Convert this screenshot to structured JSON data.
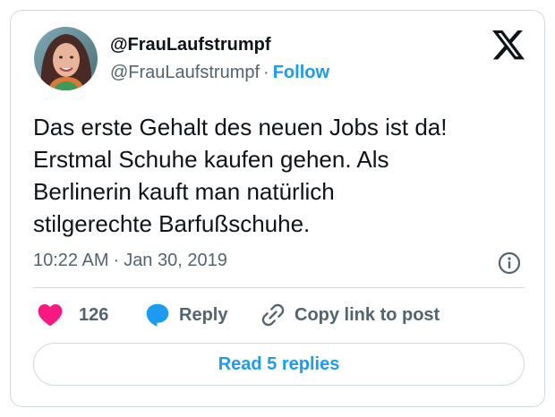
{
  "author": {
    "display_name": "@FrauLaufstrumpf",
    "handle": "@FrauLaufstrumpf",
    "separator": "·",
    "follow_label": "Follow"
  },
  "tweet": {
    "lines": [
      "Das erste Gehalt des neuen Jobs ist da!",
      "Erstmal Schuhe kaufen gehen. Als",
      "Berlinerin kauft man natürlich",
      "stilgerechte Barfußschuhe."
    ],
    "time": "10:22 AM",
    "separator": "·",
    "date": "Jan 30, 2019"
  },
  "actions": {
    "like_count": "126",
    "reply_label": "Reply",
    "copy_label": "Copy link to post"
  },
  "read_replies_label": "Read 5 replies",
  "icons": {
    "brand": "x-logo-icon",
    "info": "info-icon",
    "like": "heart-icon",
    "reply": "speech-bubble-icon",
    "copy": "link-icon"
  },
  "colors": {
    "accent": "#1d9bf0",
    "like": "#f91880",
    "text": "#0f1419",
    "muted": "#536471",
    "border": "#cfd9de"
  }
}
